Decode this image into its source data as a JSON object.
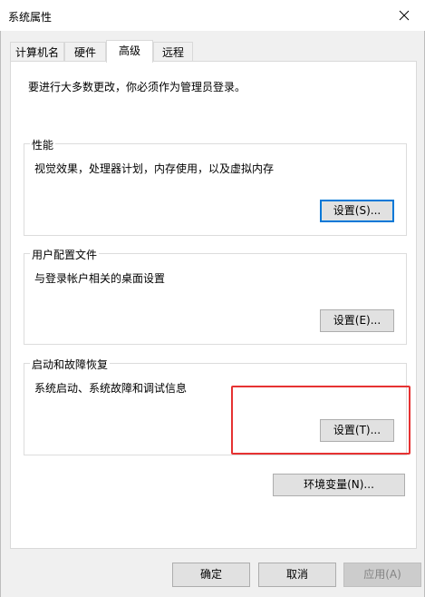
{
  "window": {
    "title": "系统属性",
    "close_icon": "close-icon"
  },
  "tabs": [
    {
      "label": "计算机名",
      "active": false
    },
    {
      "label": "硬件",
      "active": false
    },
    {
      "label": "高级",
      "active": true
    },
    {
      "label": "远程",
      "active": false
    }
  ],
  "advanced": {
    "intro": "要进行大多数更改，你必须作为管理员登录。",
    "performance": {
      "title": "性能",
      "desc": "视觉效果，处理器计划，内存使用，以及虚拟内存",
      "button": "设置(S)..."
    },
    "user_profiles": {
      "title": "用户配置文件",
      "desc": "与登录帐户相关的桌面设置",
      "button": "设置(E)..."
    },
    "startup_recovery": {
      "title": "启动和故障恢复",
      "desc": "系统启动、系统故障和调试信息",
      "button": "设置(T)..."
    },
    "env_vars_button": "环境变量(N)..."
  },
  "footer": {
    "ok": "确定",
    "cancel": "取消",
    "apply": "应用(A)"
  },
  "colors": {
    "highlight": "#e63232",
    "focus": "#0078d7"
  }
}
